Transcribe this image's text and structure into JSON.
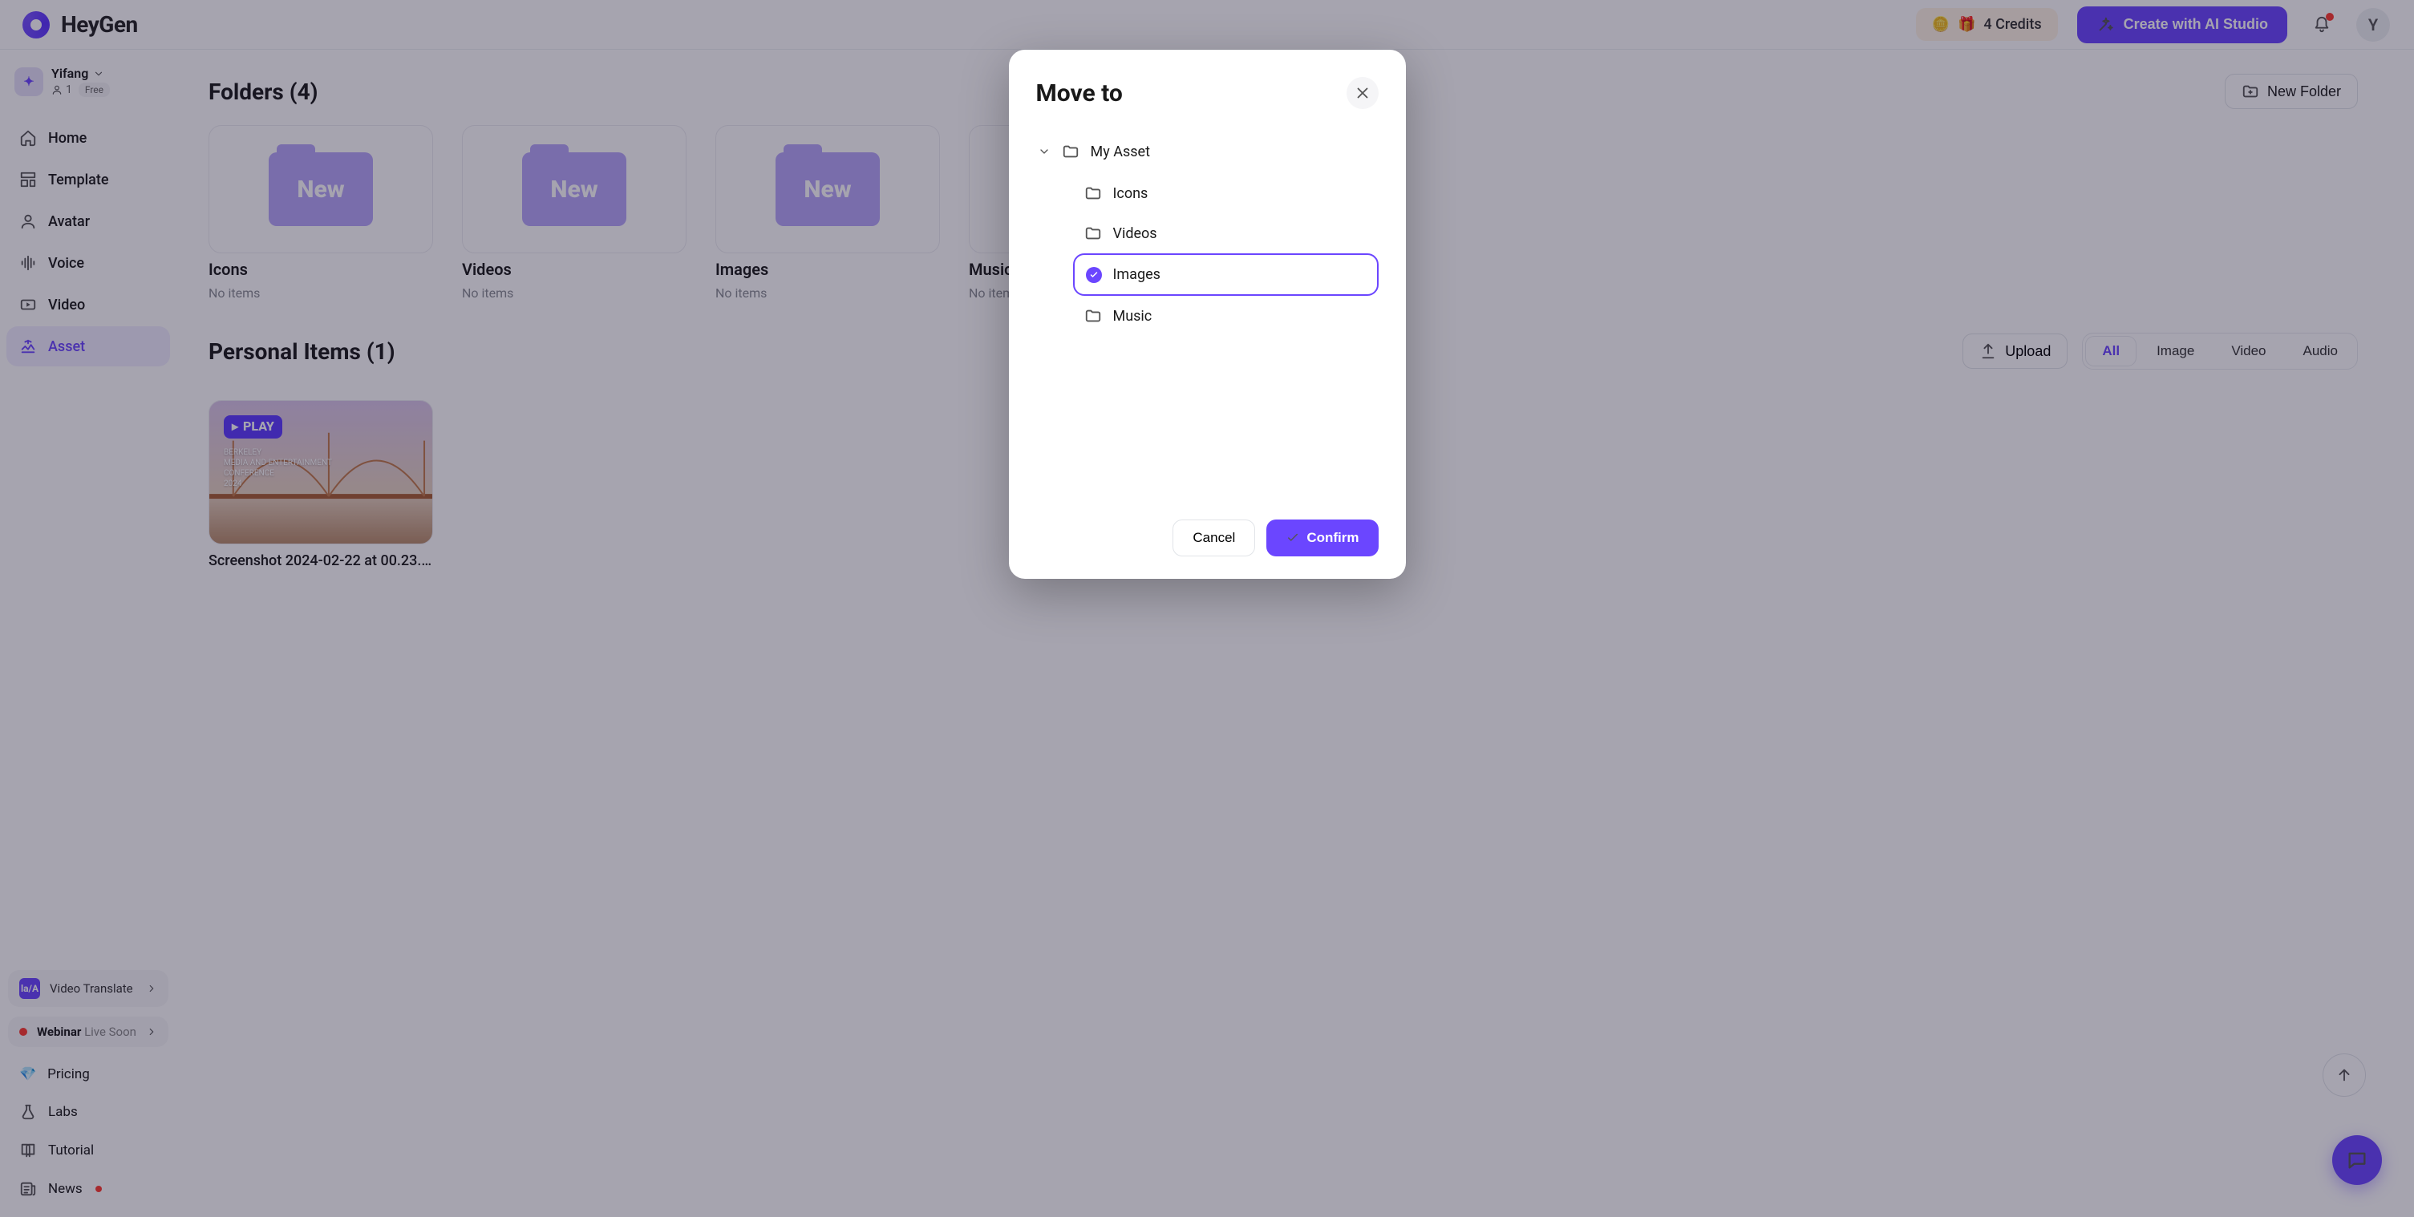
{
  "brand": {
    "name": "HeyGen"
  },
  "workspace": {
    "name": "Yifang",
    "member_count": "1",
    "plan": "Free"
  },
  "nav": {
    "home": "Home",
    "template": "Template",
    "avatar": "Avatar",
    "voice": "Voice",
    "video": "Video",
    "asset": "Asset"
  },
  "promos": {
    "video_translate": "Video Translate",
    "webinar_label": "Webinar",
    "webinar_status": "Live Soon"
  },
  "sec_nav": {
    "pricing": "Pricing",
    "labs": "Labs",
    "tutorial": "Tutorial",
    "news": "News"
  },
  "topbar": {
    "credits": "4 Credits",
    "create": "Create with AI Studio",
    "avatar_initial": "Y"
  },
  "main": {
    "folders_title": "Folders (4)",
    "new_folder": "New Folder",
    "folder_badge": "New",
    "folders": [
      {
        "name": "Icons",
        "sub": "No items"
      },
      {
        "name": "Videos",
        "sub": "No items"
      },
      {
        "name": "Images",
        "sub": "No items"
      },
      {
        "name": "Music",
        "sub": "No items"
      }
    ],
    "personal_title": "Personal Items (1)",
    "upload": "Upload",
    "filters": {
      "all": "All",
      "image": "Image",
      "video": "Video",
      "audio": "Audio"
    },
    "item": {
      "name": "Screenshot 2024-02-22 at 00.23.00.p...",
      "play_label": "PLAY",
      "conf_line1": "BERKELEY",
      "conf_line2": "MEDIA AND ENTERTAINMENT",
      "conf_line3": "CONFERENCE",
      "conf_line4": "2024"
    }
  },
  "modal": {
    "title": "Move to",
    "root": "My Asset",
    "items": {
      "icons": "Icons",
      "videos": "Videos",
      "images": "Images",
      "music": "Music"
    },
    "cancel": "Cancel",
    "confirm": "Confirm"
  }
}
